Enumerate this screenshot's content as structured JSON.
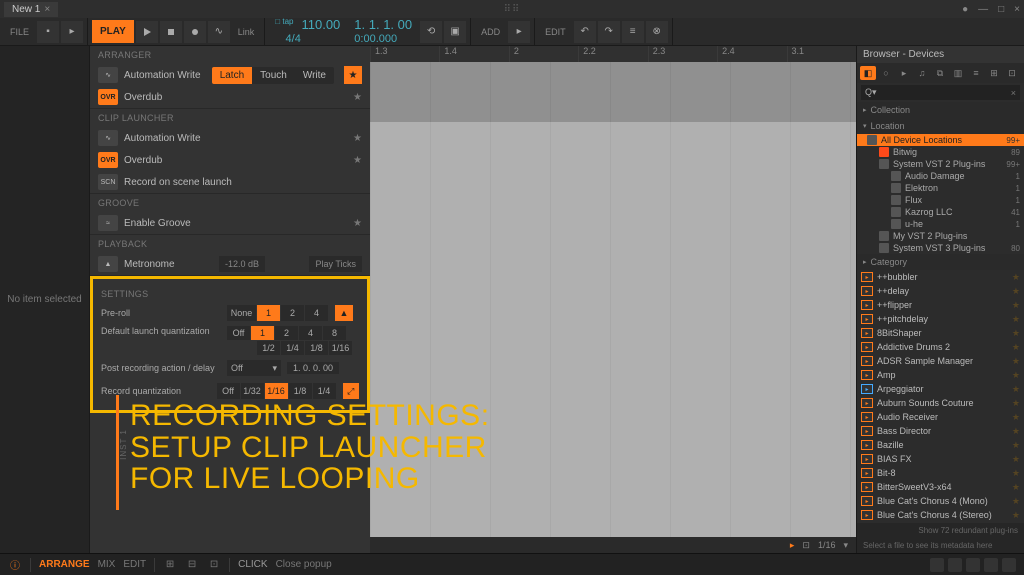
{
  "titlebar": {
    "tab_name": "New 1",
    "logo": "⠿⠿"
  },
  "toolbar": {
    "file_label": "FILE",
    "play_label": "PLAY",
    "link_label": "Link",
    "tempo": "110.00",
    "timesig": "4/4",
    "position": "1. 1. 1. 00",
    "time": "0:00.000",
    "add_label": "ADD",
    "edit_label": "EDIT"
  },
  "left_rail": {
    "msg": "No item selected"
  },
  "menu": {
    "arranger": {
      "header": "ARRANGER",
      "autowrite": "Automation Write",
      "latch": "Latch",
      "touch": "Touch",
      "write": "Write",
      "overdub": "Overdub"
    },
    "clip": {
      "header": "CLIP LAUNCHER",
      "autowrite": "Automation Write",
      "overdub": "Overdub",
      "scene": "Record on scene launch"
    },
    "groove": {
      "header": "GROOVE",
      "enable": "Enable Groove"
    },
    "playback": {
      "header": "PLAYBACK",
      "metro": "Metronome",
      "metro_val": "-12.0 dB",
      "ticks": "Play Ticks"
    },
    "settings": {
      "header": "SETTINGS",
      "preroll": "Pre-roll",
      "preroll_opts": [
        "None",
        "1",
        "2",
        "4"
      ],
      "dlq": "Default launch quantization",
      "dlq_row1": [
        "Off",
        "1",
        "2",
        "4",
        "8"
      ],
      "dlq_row2": [
        "1/2",
        "1/4",
        "1/8",
        "1/16"
      ],
      "post": "Post recording action / delay",
      "post_val": "Off",
      "post_time": "1. 0. 0. 00",
      "recq": "Record quantization",
      "recq_opts": [
        "Off",
        "1/32",
        "1/16",
        "1/8",
        "1/4"
      ]
    }
  },
  "timeline": {
    "marks": [
      "1.3",
      "1.4",
      "2",
      "2.2",
      "2.3",
      "2.4",
      "3.1"
    ],
    "zoom": "1/16"
  },
  "overlay": {
    "line1": "RECORDING SETTINGS:",
    "line2": "SETUP CLIP LAUNCHER",
    "line3": "FOR LIVE LOOPING",
    "inst": "INST 1"
  },
  "browser": {
    "title": "Browser - Devices",
    "search_prefix": "Q▾",
    "collection": "Collection",
    "location": "Location",
    "tree": [
      {
        "label": "All Device Locations",
        "count": "99+",
        "sel": true
      },
      {
        "label": "Bitwig",
        "count": "89",
        "sub": true,
        "orange": true
      },
      {
        "label": "System VST 2 Plug-ins",
        "count": "99+",
        "sub": true
      },
      {
        "label": "Audio Damage",
        "count": "1",
        "sub": 2
      },
      {
        "label": "Elektron",
        "count": "1",
        "sub": 2
      },
      {
        "label": "Flux",
        "count": "1",
        "sub": 2
      },
      {
        "label": "Kazrog LLC",
        "count": "41",
        "sub": 2
      },
      {
        "label": "u-he",
        "count": "1",
        "sub": 2
      },
      {
        "label": "My VST 2 Plug-ins",
        "count": "",
        "sub": true
      },
      {
        "label": "System VST 3 Plug-ins",
        "count": "80",
        "sub": true
      }
    ],
    "category": "Category",
    "list": [
      "++bubbler",
      "++delay",
      "++flipper",
      "++pitchdelay",
      "8BitShaper",
      "Addictive Drums 2",
      "ADSR Sample Manager",
      "Amp",
      "Arpeggiator",
      "Auburn Sounds Couture",
      "Audio Receiver",
      "Bass Director",
      "Bazille",
      "BIAS FX",
      "Bit-8",
      "BitterSweetV3-x64",
      "Blue Cat's Chorus 4 (Mono)",
      "Blue Cat's Chorus 4 (Stereo)"
    ],
    "redundant": "Show 72 redundant plug-ins",
    "footer": "Select a file to see its metadata here"
  },
  "statusbar": {
    "arrange": "ARRANGE",
    "mix": "MIX",
    "edit": "EDIT",
    "click": "CLICK",
    "hint": "Close popup"
  }
}
